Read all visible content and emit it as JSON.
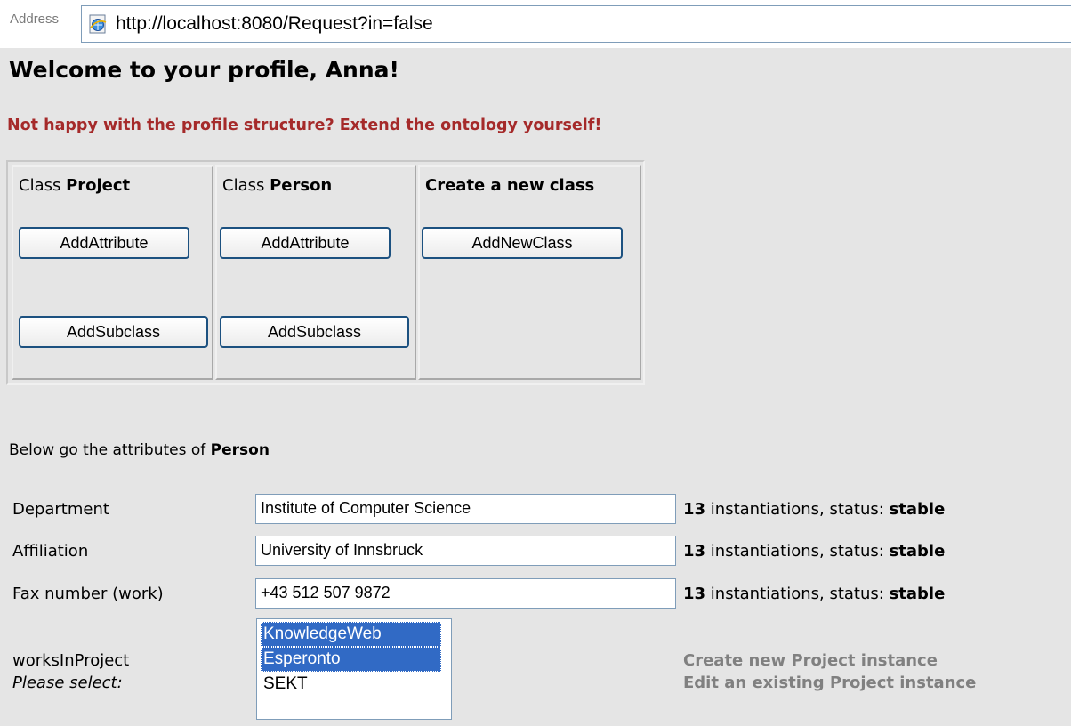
{
  "address_bar": {
    "label": "Address",
    "url": "http://localhost:8080/Request?in=false"
  },
  "page": {
    "title": "Welcome to your profile, Anna!",
    "promo": "Not happy with the profile structure? Extend the ontology yourself!"
  },
  "class_table": {
    "columns": [
      {
        "prefix": "Class ",
        "name": "Project",
        "buttons": [
          "AddAttribute",
          "AddSubclass"
        ]
      },
      {
        "prefix": "Class ",
        "name": "Person",
        "buttons": [
          "AddAttribute",
          "AddSubclass"
        ]
      },
      {
        "prefix": "",
        "name": "Create a new class",
        "buttons": [
          "AddNewClass"
        ]
      }
    ]
  },
  "attributes": {
    "intro_prefix": "Below go the attributes of ",
    "intro_class": "Person",
    "rows": [
      {
        "label": "Department",
        "value": "Institute of Computer Science",
        "count": "13",
        "count_text": " instantiations, status: ",
        "status": "stable"
      },
      {
        "label": "Affiliation",
        "value": "University of Innsbruck",
        "count": "13",
        "count_text": " instantiations, status: ",
        "status": "stable"
      },
      {
        "label": "Fax number (work)",
        "value": "+43 512 507 9872",
        "count": "13",
        "count_text": " instantiations, status: ",
        "status": "stable"
      }
    ],
    "works_in_project": {
      "label": "worksInProject",
      "hint": "Please select:",
      "options": [
        {
          "label": "KnowledgeWeb",
          "selected": true
        },
        {
          "label": "Esperonto",
          "selected": true
        },
        {
          "label": "SEKT",
          "selected": false
        }
      ],
      "links": [
        "Create new Project instance",
        "Edit an existing Project instance"
      ]
    }
  },
  "colors": {
    "background": "#e5e5e5",
    "promo": "#a52a2a",
    "selection": "#316ac5",
    "link_gray": "#808080"
  },
  "icons": {
    "browser": "ie-page-icon"
  }
}
